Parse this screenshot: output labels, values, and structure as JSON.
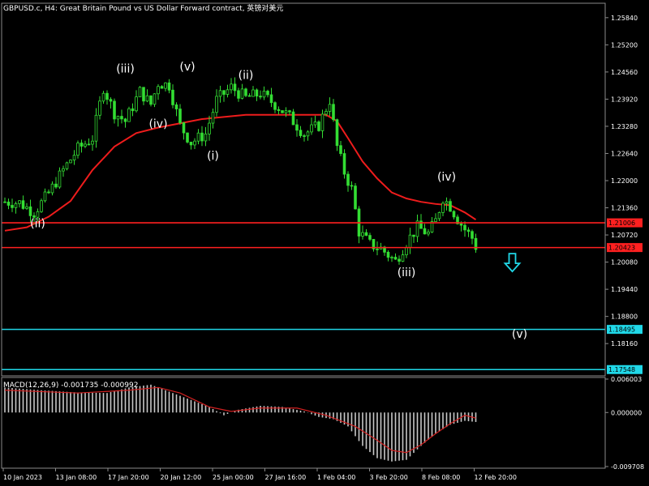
{
  "window": {
    "title": "GBPUSD.c, H4:  Great Britain Pound vs US Dollar Forward contract, 英镑对美元"
  },
  "chart_data": {
    "type": "candlestick",
    "symbol": "GBPUSD.c",
    "timeframe": "H4",
    "price_axis": {
      "ylim": [
        1.174,
        1.2618
      ],
      "ticks": [
        "1.25840",
        "1.25200",
        "1.24560",
        "1.23920",
        "1.23280",
        "1.22640",
        "1.22000",
        "1.21360",
        "1.20720",
        "1.20080",
        "1.19440",
        "1.18800",
        "1.18160"
      ]
    },
    "time_axis": {
      "labels": [
        "10 Jan 2023",
        "13 Jan 08:00",
        "17 Jan 20:00",
        "20 Jan 12:00",
        "25 Jan 00:00",
        "27 Jan 16:00",
        "1 Feb 04:00",
        "3 Feb 20:00",
        "8 Feb 08:00",
        "12 Feb 20:00"
      ]
    },
    "price_path": [
      [
        0,
        1.215
      ],
      [
        4,
        1.2148
      ],
      [
        8,
        1.2125
      ],
      [
        12,
        1.217
      ],
      [
        16,
        1.2225
      ],
      [
        20,
        1.2275
      ],
      [
        24,
        1.23
      ],
      [
        27,
        1.242
      ],
      [
        30,
        1.236
      ],
      [
        33,
        1.234
      ],
      [
        37,
        1.241
      ],
      [
        40,
        1.238
      ],
      [
        42,
        1.243
      ],
      [
        45,
        1.2425
      ],
      [
        48,
        1.233
      ],
      [
        51,
        1.229
      ],
      [
        55,
        1.231
      ],
      [
        58,
        1.239
      ],
      [
        62,
        1.242
      ],
      [
        66,
        1.2395
      ],
      [
        70,
        1.2405
      ],
      [
        74,
        1.238
      ],
      [
        78,
        1.235
      ],
      [
        82,
        1.231
      ],
      [
        86,
        1.233
      ],
      [
        89,
        1.239
      ],
      [
        91,
        1.228
      ],
      [
        93,
        1.222
      ],
      [
        95,
        1.218
      ],
      [
        97,
        1.208
      ],
      [
        100,
        1.205
      ],
      [
        103,
        1.204
      ],
      [
        107,
        1.201
      ],
      [
        110,
        1.2055
      ],
      [
        113,
        1.209
      ],
      [
        116,
        1.2075
      ],
      [
        118,
        1.2105
      ],
      [
        120,
        1.216
      ],
      [
        122,
        1.214
      ],
      [
        124,
        1.211
      ],
      [
        126,
        1.2085
      ],
      [
        128,
        1.2065
      ],
      [
        129,
        1.2045
      ]
    ],
    "moving_average": [
      [
        0,
        1.2082
      ],
      [
        6,
        1.209
      ],
      [
        12,
        1.2115
      ],
      [
        18,
        1.2152
      ],
      [
        24,
        1.2225
      ],
      [
        30,
        1.228
      ],
      [
        36,
        1.2312
      ],
      [
        42,
        1.2325
      ],
      [
        48,
        1.2335
      ],
      [
        54,
        1.2345
      ],
      [
        60,
        1.235
      ],
      [
        66,
        1.2355
      ],
      [
        72,
        1.2355
      ],
      [
        78,
        1.2355
      ],
      [
        84,
        1.2355
      ],
      [
        88,
        1.2355
      ],
      [
        91,
        1.234
      ],
      [
        94,
        1.23
      ],
      [
        98,
        1.2245
      ],
      [
        102,
        1.2205
      ],
      [
        106,
        1.2172
      ],
      [
        110,
        1.2158
      ],
      [
        114,
        1.215
      ],
      [
        118,
        1.2145
      ],
      [
        122,
        1.2142
      ],
      [
        126,
        1.2125
      ],
      [
        129,
        1.2108
      ]
    ],
    "levels": [
      {
        "value": "1.21006",
        "num": 1.21006,
        "color": "#ff2020"
      },
      {
        "value": "1.20423",
        "num": 1.20423,
        "color": "#ff2020"
      },
      {
        "value": "1.18495",
        "num": 1.18495,
        "color": "#20d8e8"
      },
      {
        "value": "1.17548",
        "num": 1.17548,
        "color": "#20d8e8"
      }
    ],
    "waves": [
      {
        "label": "(ii)",
        "i": 9,
        "y": 1.209
      },
      {
        "label": "(iii)",
        "i": 33,
        "y": 1.2455
      },
      {
        "label": "(iv)",
        "i": 42,
        "y": 1.2325
      },
      {
        "label": "(v)",
        "i": 50,
        "y": 1.246
      },
      {
        "label": "(i)",
        "i": 57,
        "y": 1.225
      },
      {
        "label": "(ii)",
        "i": 66,
        "y": 1.244
      },
      {
        "label": "(iii)",
        "i": 110,
        "y": 1.1975
      },
      {
        "label": "(iv)",
        "i": 121,
        "y": 1.22
      },
      {
        "label": "(v)",
        "i": 141,
        "y": 1.183
      }
    ],
    "arrow": {
      "i": 139,
      "y": 1.2005,
      "color": "#20d8e8"
    },
    "macd": {
      "label": "MACD(12,26,9) -0.001735 -0.000992",
      "ylim": [
        -0.009708,
        0.006003
      ],
      "ticks": [
        "0.006003",
        "0.000000",
        "-0.009708"
      ],
      "hist_path": [
        [
          0,
          0.0045
        ],
        [
          10,
          0.004
        ],
        [
          20,
          0.0036
        ],
        [
          28,
          0.0035
        ],
        [
          34,
          0.0045
        ],
        [
          40,
          0.005
        ],
        [
          44,
          0.004
        ],
        [
          50,
          0.0025
        ],
        [
          56,
          0.001
        ],
        [
          60,
          -0.0005
        ],
        [
          64,
          0.0005
        ],
        [
          70,
          0.0012
        ],
        [
          76,
          0.001
        ],
        [
          82,
          0.0002
        ],
        [
          86,
          -0.0008
        ],
        [
          90,
          -0.0012
        ],
        [
          94,
          -0.0025
        ],
        [
          98,
          -0.006
        ],
        [
          102,
          -0.0082
        ],
        [
          106,
          -0.0088
        ],
        [
          110,
          -0.0085
        ],
        [
          114,
          -0.006
        ],
        [
          118,
          -0.0038
        ],
        [
          122,
          -0.0022
        ],
        [
          126,
          -0.0015
        ],
        [
          129,
          -0.0017
        ]
      ],
      "signal_path": [
        [
          0,
          0.004
        ],
        [
          20,
          0.0035
        ],
        [
          34,
          0.004
        ],
        [
          42,
          0.0045
        ],
        [
          48,
          0.0035
        ],
        [
          56,
          0.001
        ],
        [
          62,
          0.0002
        ],
        [
          70,
          0.0008
        ],
        [
          80,
          0.0008
        ],
        [
          88,
          -0.0005
        ],
        [
          96,
          -0.0025
        ],
        [
          102,
          -0.005
        ],
        [
          106,
          -0.0068
        ],
        [
          110,
          -0.0072
        ],
        [
          114,
          -0.0058
        ],
        [
          118,
          -0.0038
        ],
        [
          122,
          -0.002
        ],
        [
          126,
          -0.0005
        ],
        [
          129,
          -0.001
        ]
      ]
    }
  },
  "colors": {
    "bull": "#33dd33",
    "bear": "#33dd33",
    "ma": "#ee1c1c",
    "macd_hist": "#c8c8c8",
    "macd_signal": "#d02020",
    "grid": "#3a3a3a",
    "axis": "#8a8a8a"
  }
}
